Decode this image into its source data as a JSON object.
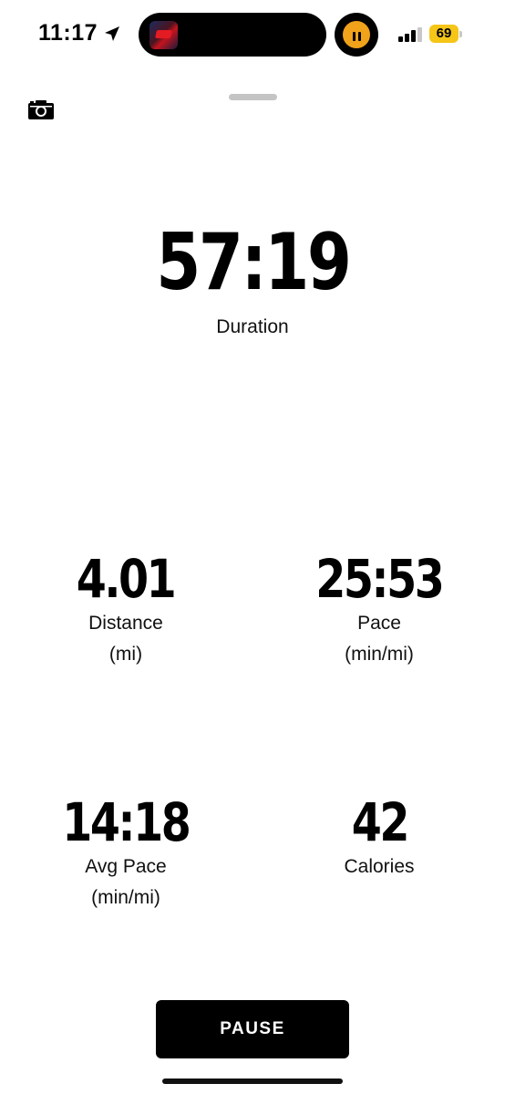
{
  "status_bar": {
    "time": "11:17",
    "battery_level": "69",
    "battery_color": "#f5c518",
    "timer_color": "#f0a21a"
  },
  "icons": {
    "location": "location-arrow-icon",
    "camera": "camera-icon",
    "pause": "pause-icon"
  },
  "duration": {
    "value": "57:19",
    "label": "Duration"
  },
  "stats": {
    "distance": {
      "value": "4.01",
      "label": "Distance",
      "unit": "(mi)"
    },
    "pace": {
      "value": "25:53",
      "label": "Pace",
      "unit": "(min/mi)"
    },
    "avg_pace": {
      "value": "14:18",
      "label": "Avg Pace",
      "unit": "(min/mi)"
    },
    "calories": {
      "value": "42",
      "label": "Calories"
    }
  },
  "actions": {
    "pause_label": "PAUSE"
  }
}
